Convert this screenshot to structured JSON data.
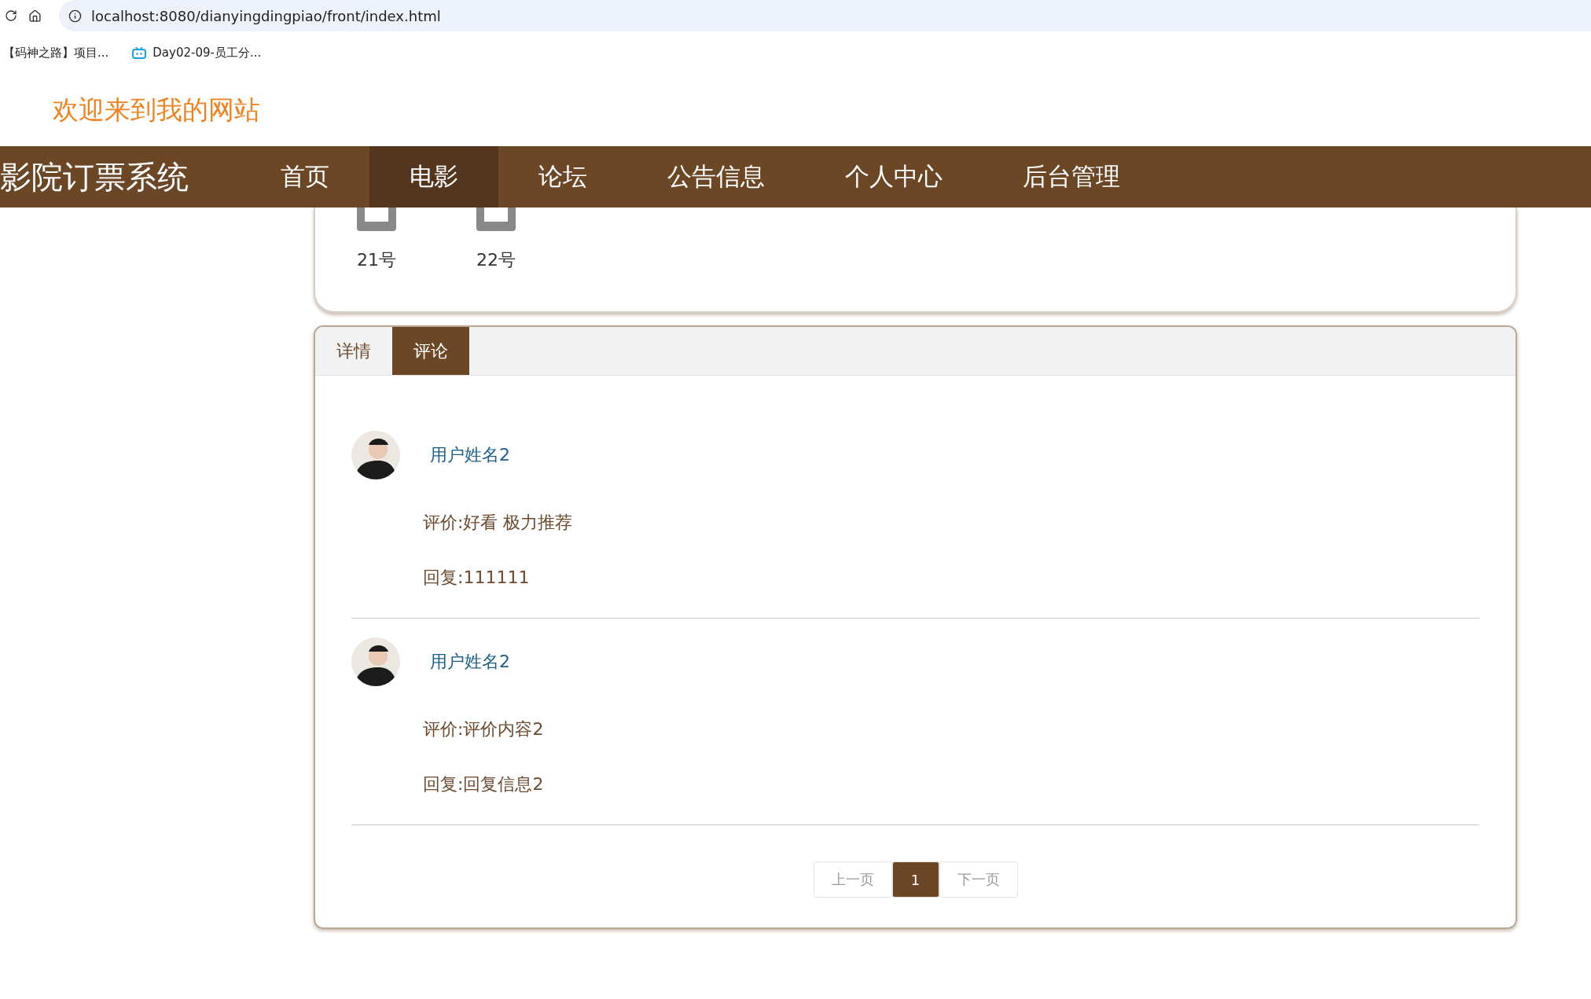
{
  "browser": {
    "url": "localhost:8080/dianyingdingpiao/front/index.html",
    "bookmarks": [
      {
        "label": "【码神之路】项目...",
        "kind": "plain"
      },
      {
        "label": "Day02-09-员工分...",
        "kind": "tv"
      }
    ]
  },
  "welcome": "欢迎来到我的网站",
  "nav": {
    "brand": "影院订票系统",
    "items": [
      {
        "label": "首页",
        "selected": false
      },
      {
        "label": "电影",
        "selected": true
      },
      {
        "label": "论坛",
        "selected": false
      },
      {
        "label": "公告信息",
        "selected": false
      },
      {
        "label": "个人中心",
        "selected": false
      },
      {
        "label": "后台管理",
        "selected": false
      }
    ]
  },
  "seats": [
    {
      "label": "21号"
    },
    {
      "label": "22号"
    }
  ],
  "tabs": [
    {
      "label": "详情",
      "selected": false
    },
    {
      "label": "评论",
      "selected": true
    }
  ],
  "comments": [
    {
      "user": "用户姓名2",
      "review": "评价:好看 极力推荐",
      "reply": "回复:111111"
    },
    {
      "user": "用户姓名2",
      "review": "评价:评价内容2",
      "reply": "回复:回复信息2"
    }
  ],
  "pagination": {
    "prev": {
      "label": "上一页",
      "disabled": true
    },
    "pages": [
      {
        "label": "1",
        "selected": true
      }
    ],
    "next": {
      "label": "下一页",
      "disabled": true
    }
  }
}
